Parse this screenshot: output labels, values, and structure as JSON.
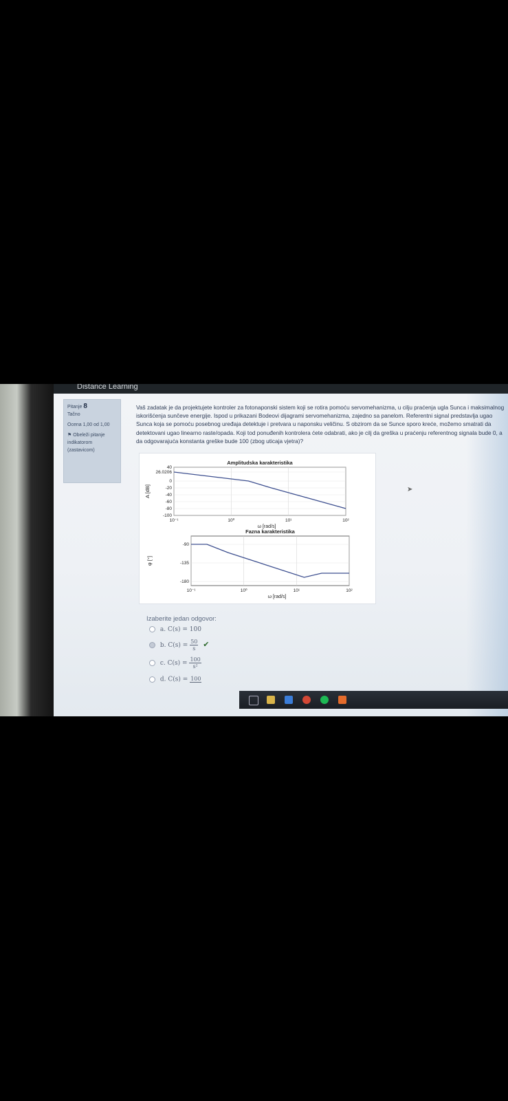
{
  "app": {
    "title": "Distance Learning"
  },
  "question_info": {
    "number_label": "Pitanje",
    "number": "8",
    "status": "Tačno",
    "grade": "Ocena 1,00 od 1,00",
    "flag_label": "Obeleži pitanje indikatorom (zastavicom)"
  },
  "question_text": "Vaš zadatak je da projektujete kontroler za fotonaponski sistem koji se rotira pomoću servomehanizma, u cilju praćenja ugla Sunca i maksimalnog iskorišćenja sunčeve energije. Ispod u prikazani Bodeovi dijagrami servomehanizma, zajedno sa panelom. Referentni signal predstavlja ugao Sunca koja se pomoću posebnog uređaja detektuje i pretvara u naponsku veličinu. S obzirom da se Sunce sporo kreće, možemo smatrati da detektovani ugao linearno raste/opada. Koji tod ponuđenih kontrolera ćete odabrati, ako je cilj da greška u praćenju referentnog signala bude 0, a da odgovarajuća konstanta greške bude 100 (zbog uticaja vjetra)?",
  "chart_data": [
    {
      "type": "line",
      "title": "Amplitudska karakteristika",
      "xlabel": "ω [rad/s]",
      "ylabel": "A [dB]",
      "xscale": "log",
      "xlim": [
        0.1,
        100
      ],
      "ylim": [
        -100,
        40
      ],
      "x_ticks": [
        "10⁻¹",
        "10⁰",
        "10¹",
        "10²"
      ],
      "y_ticks": [
        "40",
        "26.0206",
        "0",
        "-20",
        "-40",
        "-60",
        "-80",
        "-100"
      ],
      "grid": true,
      "series": [
        {
          "x": [
            0.1,
            2,
            5,
            100
          ],
          "y": [
            26.0206,
            0,
            -20,
            -80
          ]
        }
      ]
    },
    {
      "type": "line",
      "title": "Fazna karakteristika",
      "xlabel": "ω [rad/s]",
      "ylabel": "φ [°]",
      "xscale": "log",
      "xlim": [
        0.1,
        100
      ],
      "ylim": [
        -190,
        -70
      ],
      "x_ticks": [
        "10⁻¹",
        "10⁰",
        "10¹",
        "10²"
      ],
      "y_ticks": [
        "-90",
        "-135",
        "-180"
      ],
      "grid": true,
      "series": [
        {
          "x": [
            0.1,
            0.2,
            0.5,
            14,
            30,
            100
          ],
          "y": [
            -90,
            -90,
            -110,
            -170,
            -160,
            -160
          ]
        }
      ]
    }
  ],
  "answers": {
    "prompt": "Izaberite jedan odgovor:",
    "options": [
      {
        "letter": "a.",
        "expr": "C(s) = 100",
        "selected": false
      },
      {
        "letter": "b.",
        "expr": "C(s) =",
        "num": "50",
        "den": "s",
        "selected": true,
        "correct": true
      },
      {
        "letter": "c.",
        "expr": "C(s) =",
        "num": "100",
        "den": "s²",
        "selected": false
      },
      {
        "letter": "d.",
        "expr": "C(s) =",
        "num": "100",
        "selected": false
      }
    ]
  },
  "taskbar": {
    "icons": [
      "task-view-icon",
      "file-explorer-icon",
      "mail-icon",
      "chrome-icon",
      "spotify-icon",
      "media-icon"
    ]
  }
}
